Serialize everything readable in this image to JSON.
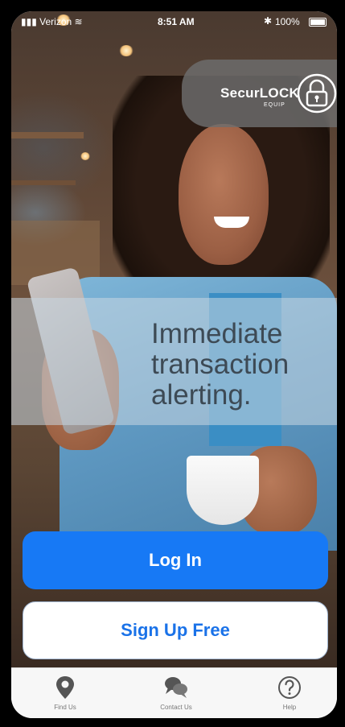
{
  "status_bar": {
    "carrier": "Verizon",
    "time": "8:51 AM",
    "battery": "100%"
  },
  "logo": {
    "name": "SecurLOCK",
    "sub": "EQUIP"
  },
  "banner": {
    "line1": "Immediate",
    "line2": "transaction",
    "line3": "alerting."
  },
  "buttons": {
    "login": "Log In",
    "signup": "Sign Up Free"
  },
  "tabbar": {
    "items": [
      {
        "label": "Find Us",
        "icon": "location-pin-icon"
      },
      {
        "label": "Contact Us",
        "icon": "chat-bubbles-icon"
      },
      {
        "label": "Help",
        "icon": "question-mark-icon"
      }
    ]
  },
  "colors": {
    "primary": "#1779f5",
    "signup_text": "#1a72e8"
  }
}
